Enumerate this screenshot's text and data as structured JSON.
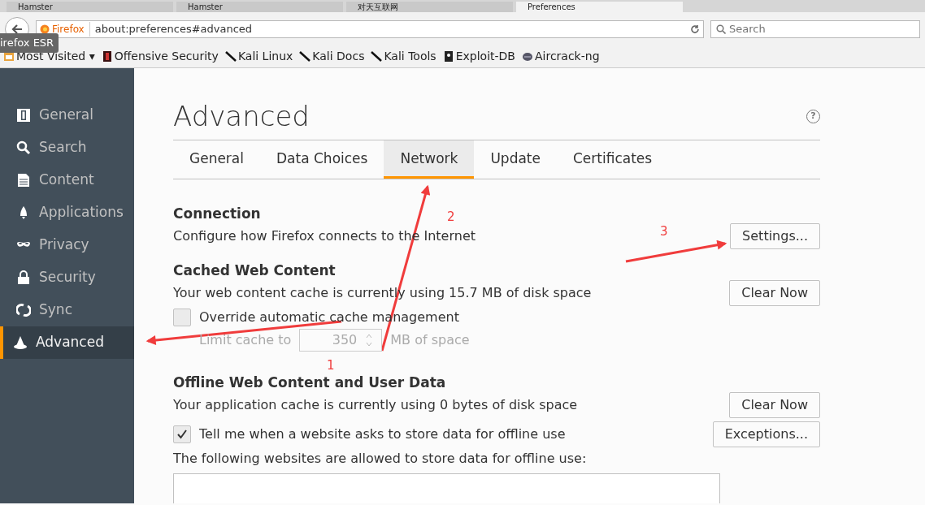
{
  "browser_tabs": [
    {
      "title": "Hamster",
      "selected": false
    },
    {
      "title": "Hamster",
      "selected": false
    },
    {
      "title": "对天互联网",
      "selected": false
    },
    {
      "title": "Preferences",
      "selected": true
    }
  ],
  "address_bar": {
    "identity": "Firefox",
    "url": "about:preferences#advanced"
  },
  "search": {
    "placeholder": "Search"
  },
  "tooltip": "irefox ESR",
  "bookmarks": [
    {
      "label": "Most Visited ▾"
    },
    {
      "label": "Offensive Security"
    },
    {
      "label": "Kali Linux"
    },
    {
      "label": "Kali Docs"
    },
    {
      "label": "Kali Tools"
    },
    {
      "label": "Exploit-DB"
    },
    {
      "label": "Aircrack-ng"
    }
  ],
  "sidebar": {
    "items": [
      {
        "label": "General",
        "selected": false
      },
      {
        "label": "Search",
        "selected": false
      },
      {
        "label": "Content",
        "selected": false
      },
      {
        "label": "Applications",
        "selected": false
      },
      {
        "label": "Privacy",
        "selected": false
      },
      {
        "label": "Security",
        "selected": false
      },
      {
        "label": "Sync",
        "selected": false
      },
      {
        "label": "Advanced",
        "selected": true
      }
    ]
  },
  "page": {
    "title": "Advanced",
    "help": "?"
  },
  "tabs": [
    {
      "label": "General",
      "selected": false
    },
    {
      "label": "Data Choices",
      "selected": false
    },
    {
      "label": "Network",
      "selected": true
    },
    {
      "label": "Update",
      "selected": false
    },
    {
      "label": "Certificates",
      "selected": false
    }
  ],
  "connection": {
    "heading": "Connection",
    "description": "Configure how Firefox connects to the Internet",
    "button": "Settings..."
  },
  "cache": {
    "heading": "Cached Web Content",
    "description": "Your web content cache is currently using 15.7 MB of disk space",
    "button": "Clear Now",
    "override": {
      "label": "Override automatic cache management",
      "checked": false
    },
    "limit_label": "Limit cache to",
    "limit_value": "350",
    "limit_unit": "MB of space",
    "limit_disabled": true
  },
  "offline": {
    "heading": "Offline Web Content and User Data",
    "description": "Your application cache is currently using 0 bytes of disk space",
    "button": "Clear Now",
    "notify": {
      "label": "Tell me when a website asks to store data for offline use",
      "checked": true
    },
    "exceptions_button": "Exceptions...",
    "list_label": "The following websites are allowed to store data for offline use:"
  },
  "annotations": [
    {
      "label": "1"
    },
    {
      "label": "2"
    },
    {
      "label": "3"
    }
  ]
}
